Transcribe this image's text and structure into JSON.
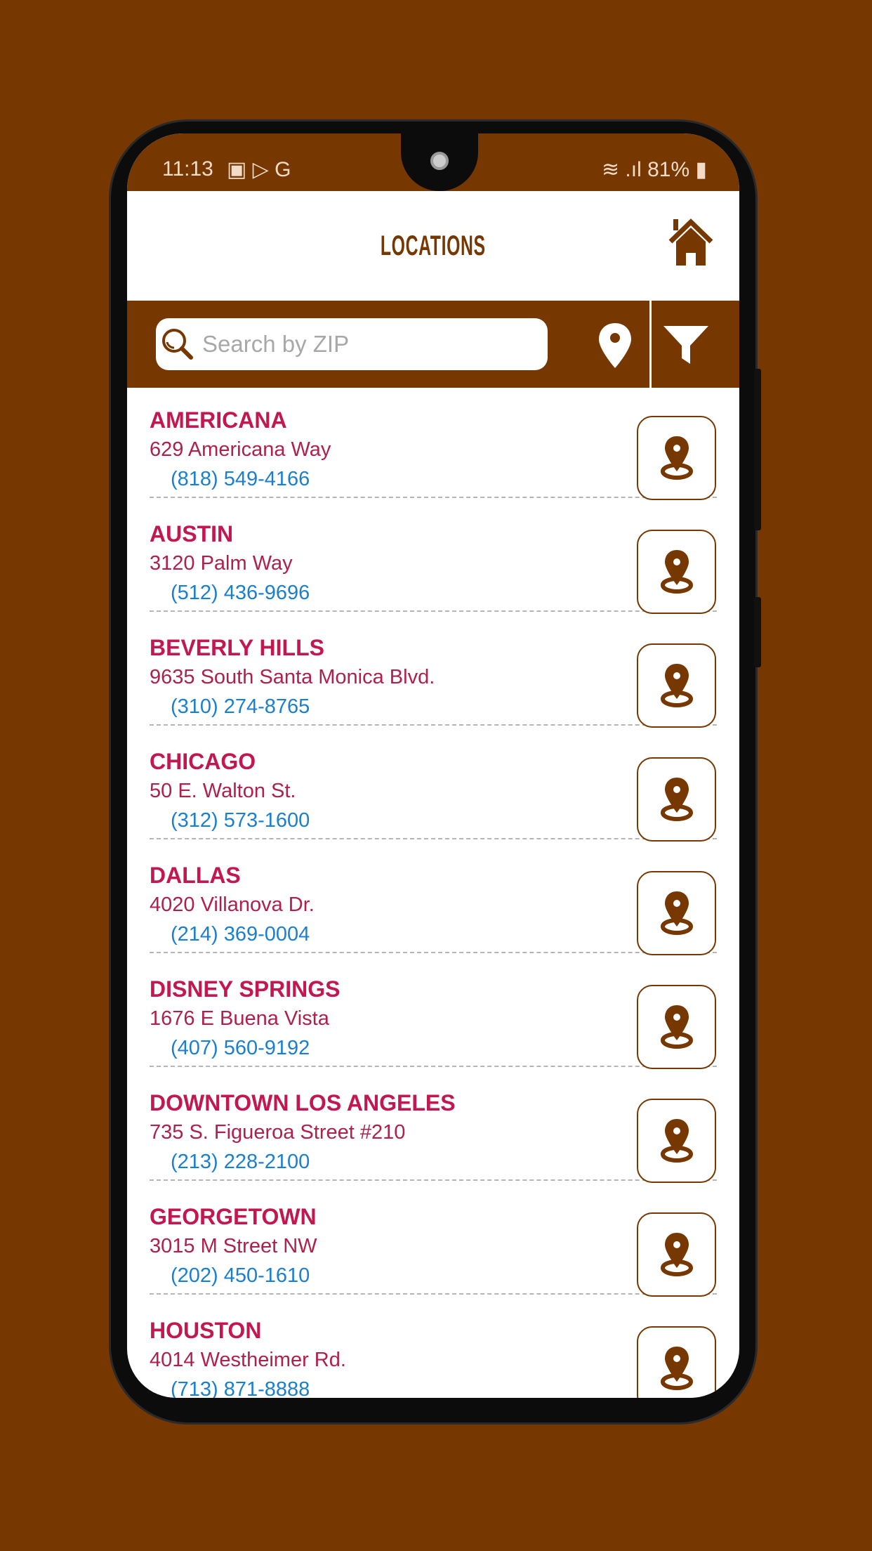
{
  "status_bar": {
    "time": "11:13",
    "battery": "81%",
    "icons": [
      "gallery-icon",
      "play-store-icon",
      "google-icon",
      "wifi-icon",
      "signal-icon",
      "battery-icon"
    ]
  },
  "header": {
    "title": "LOCATIONS",
    "home_icon": "home-icon"
  },
  "search": {
    "placeholder": "Search by ZIP",
    "value": ""
  },
  "colors": {
    "brand": "#763700",
    "name": "#c2174f",
    "phone": "#1b7fd1"
  },
  "locations": [
    {
      "name": "AMERICANA",
      "address": "629 Americana Way",
      "phone": "(818) 549-4166"
    },
    {
      "name": "AUSTIN",
      "address": "3120 Palm Way",
      "phone": "(512) 436-9696"
    },
    {
      "name": "BEVERLY HILLS",
      "address": "9635 South Santa Monica Blvd.",
      "phone": "(310) 274-8765"
    },
    {
      "name": "CHICAGO",
      "address": "50 E. Walton St.",
      "phone": "(312) 573-1600"
    },
    {
      "name": "DALLAS",
      "address": "4020 Villanova Dr.",
      "phone": "(214) 369-0004"
    },
    {
      "name": "DISNEY SPRINGS",
      "address": "1676 E Buena Vista",
      "phone": "(407) 560-9192"
    },
    {
      "name": "DOWNTOWN LOS ANGELES",
      "address": "735 S. Figueroa Street #210",
      "phone": "(213) 228-2100"
    },
    {
      "name": "GEORGETOWN",
      "address": "3015 M Street NW",
      "phone": "(202) 450-1610"
    },
    {
      "name": "HOUSTON",
      "address": "4014 Westheimer Rd.",
      "phone": "(713) 871-8888"
    }
  ]
}
